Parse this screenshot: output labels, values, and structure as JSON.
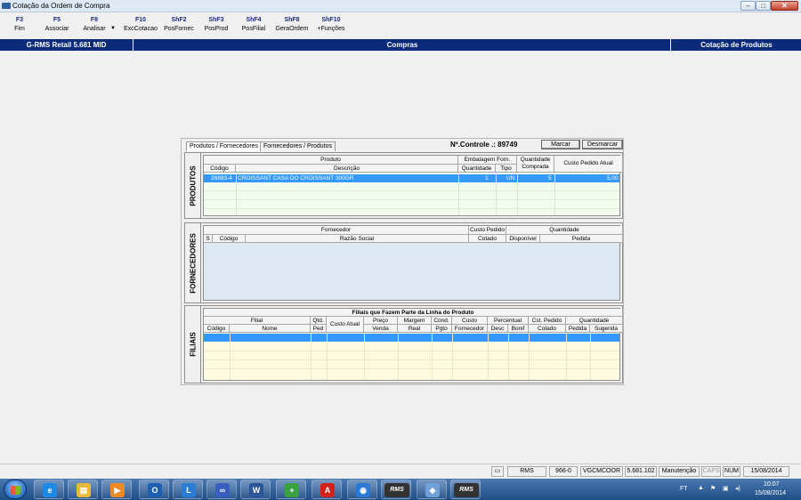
{
  "window": {
    "title": "Cotação da Ordem de Compra",
    "buttons": {
      "minimize": "–",
      "maximize": "□",
      "close": "✕"
    }
  },
  "toolbar": {
    "keys": [
      {
        "key": "F3",
        "label": "Fim"
      },
      {
        "key": "F5",
        "label": "Associar"
      },
      {
        "key": "F8",
        "label": "Analisar"
      },
      {
        "key": "F10",
        "label": "ExcCotacao"
      },
      {
        "key": "ShF2",
        "label": "PosFornec"
      },
      {
        "key": "ShF3",
        "label": "PosProd"
      },
      {
        "key": "ShF4",
        "label": "PosFilial"
      },
      {
        "key": "ShF8",
        "label": "GeraOrdem"
      },
      {
        "key": "ShF10",
        "label": "+Funções"
      }
    ]
  },
  "header": {
    "version": "G-RMS Retail 5.681 MID",
    "module": "Compras",
    "screen": "Cotação de Produtos"
  },
  "dialog": {
    "tabs": [
      "Produtos / Fornecedores",
      "Fornecedores / Produtos"
    ],
    "controle": "Nº.Controle .: 89749",
    "marcar": "Marcar",
    "desmarcar": "Desmarcar",
    "produtos": {
      "label": "PRODUTOS",
      "group_headers": {
        "produto": "Produto",
        "embalagem": "Embalagem Forn.",
        "qtd_comprada": "Quantidade Comprada",
        "custo": "Custo Pedido Atual"
      },
      "columns": {
        "codigo": "Código",
        "descricao": "Descrição",
        "quantidade": "Quantidade",
        "tipo": "Tipo"
      },
      "rows": [
        {
          "codigo": "28893-4",
          "descricao": "CROISSANT CASA DO CROISSANT 300GR",
          "quantidade": "1",
          "tipo": "UN",
          "qtd_comprada": "5",
          "custo": "5,00"
        }
      ]
    },
    "fornecedores": {
      "label": "FORNECEDORES",
      "group_headers": {
        "fornecedor": "Fornecedor",
        "custo": "Custo Pedido",
        "quantidade": "Quantidade"
      },
      "columns": {
        "s": "S",
        "codigo": "Código",
        "razao": "Razão Social",
        "cotado": "Cotado",
        "disponivel": "Disponível",
        "pedida": "Pedida"
      }
    },
    "filiais": {
      "label": "FILIAIS",
      "caption": "Filiais que Fazem Parte da Linha do Produto",
      "group_headers": {
        "filial": "Filial",
        "percentual": "Percentual",
        "quantidade": "Quantidade"
      },
      "columns": {
        "codigo": "Código",
        "nome": "Nome",
        "qtd_ped_1": "Qtd.",
        "qtd_ped_2": "Ped",
        "custo_atual": "Custo Atual",
        "preco_1": "Preço",
        "preco_2": "Venda",
        "margem_1": "Margem",
        "margem_2": "Real",
        "cond_1": "Cond.",
        "cond_2": "Pgto",
        "custo_forn_1": "Custo",
        "custo_forn_2": "Fornecedor",
        "desc": "Desc",
        "bonif": "Bonif",
        "cst_1": "Cst. Pedido",
        "cst_2": "Cotado",
        "pedida": "Pedida",
        "sugerida": "Sugerida"
      }
    }
  },
  "status": {
    "cells": [
      "RMS",
      "966-0",
      "VGCMCOOR",
      "5.681.102",
      "Manutenção",
      "CAPS",
      "NUM",
      "15/08/2014"
    ]
  },
  "taskbar": {
    "apps": [
      {
        "icon": "internet-explorer-icon",
        "glyph": "e",
        "color": "#1e88e5"
      },
      {
        "icon": "file-explorer-icon",
        "glyph": "▤",
        "color": "#e8b93a"
      },
      {
        "icon": "media-player-icon",
        "glyph": "▶",
        "color": "#f08a24"
      },
      {
        "icon": "outlook-icon",
        "glyph": "O",
        "color": "#1f5fb0"
      },
      {
        "icon": "lync-icon",
        "glyph": "L",
        "color": "#2b7cd3"
      },
      {
        "icon": "connection-icon",
        "glyph": "∞",
        "color": "#3a5ec0"
      },
      {
        "icon": "word-icon",
        "glyph": "W",
        "color": "#2a5699"
      },
      {
        "icon": "installer-icon",
        "glyph": "+",
        "color": "#3aa040"
      },
      {
        "icon": "pdf-reader-icon",
        "glyph": "A",
        "color": "#d3221c"
      },
      {
        "icon": "network-icon",
        "glyph": "◉",
        "color": "#2c7ad6"
      },
      {
        "icon": "rms-app-icon",
        "glyph": "RMS",
        "color": "#333333"
      },
      {
        "icon": "notes-app-icon",
        "glyph": "◆",
        "color": "#6fa0d8"
      },
      {
        "icon": "rms-app-icon-2",
        "glyph": "RMS",
        "color": "#333333"
      }
    ],
    "tray": {
      "lang": "FT",
      "time": "10:07",
      "date": "15/08/2014"
    }
  }
}
